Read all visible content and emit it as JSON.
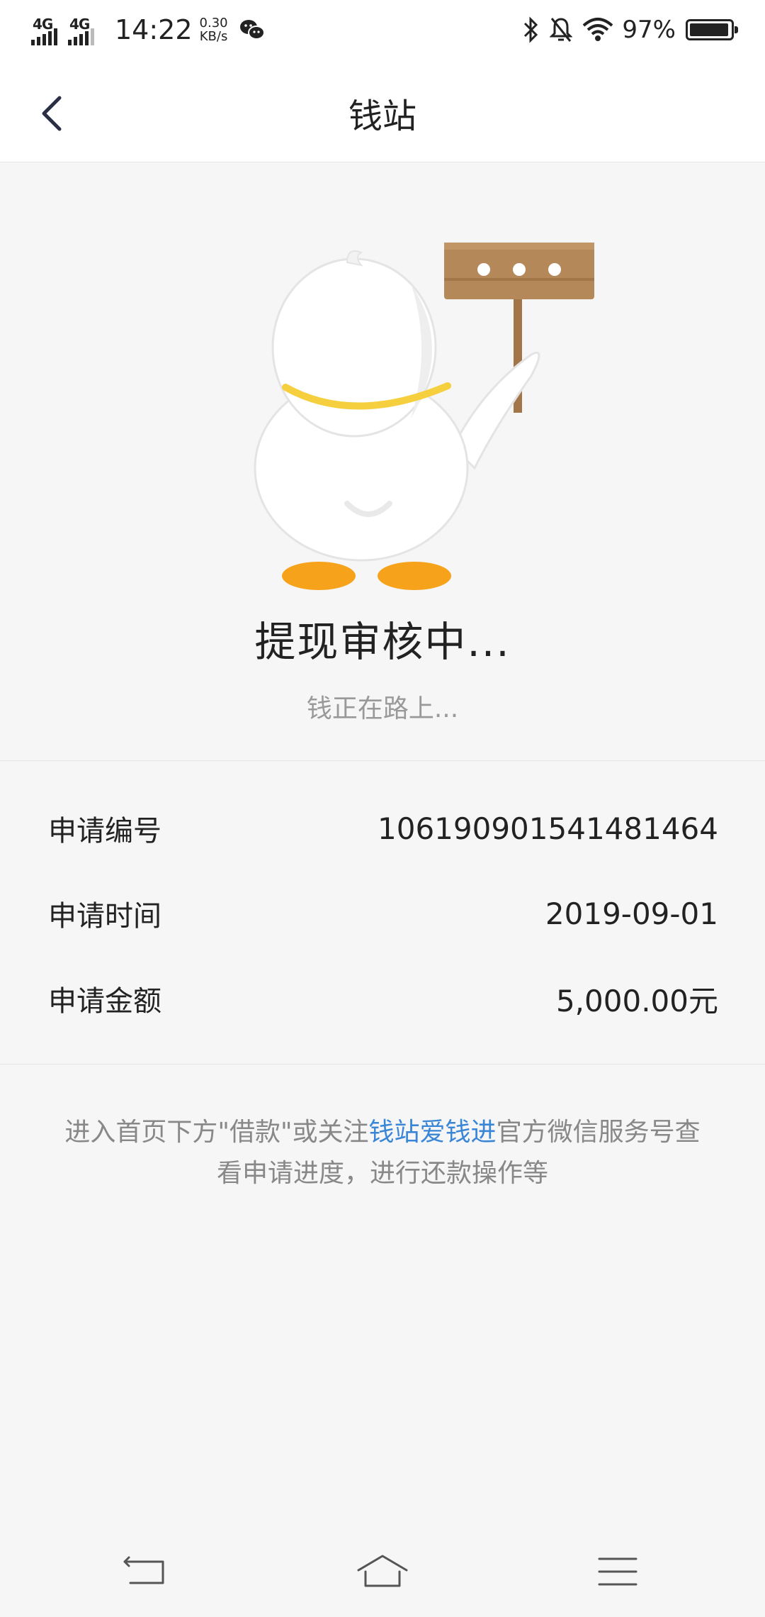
{
  "status_bar": {
    "signal1": "4G",
    "signal2": "4G",
    "time": "14:22",
    "speed_value": "0.30",
    "speed_unit": "KB/s",
    "battery_percent": "97%",
    "battery_level": 0.97
  },
  "header": {
    "title": "钱站"
  },
  "status": {
    "title": "提现审核中...",
    "subtitle": "钱正在路上..."
  },
  "details": [
    {
      "label": "申请编号",
      "value": "106190901541481464"
    },
    {
      "label": "申请时间",
      "value": "2019-09-01"
    },
    {
      "label": "申请金额",
      "value": "5,000.00元"
    }
  ],
  "notice": {
    "before": "进入首页下方\"借款\"或关注",
    "link": "钱站爱钱进",
    "after": "官方微信服务号查看申请进度，进行还款操作等"
  },
  "colors": {
    "accent_link": "#3a86d6",
    "background": "#f6f6f6",
    "sign": "#b5885a",
    "collar": "#f5cf3d",
    "feet": "#f7a21b"
  }
}
